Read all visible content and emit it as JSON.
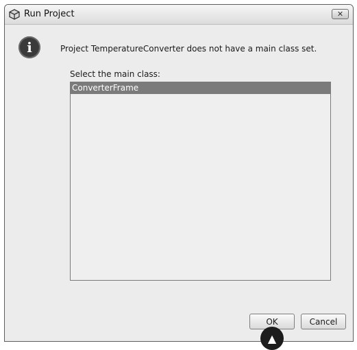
{
  "window": {
    "title": "Run Project",
    "close_symbol": "✕"
  },
  "dialog": {
    "info_icon": "i",
    "message": "Project TemperatureConverter does not have a main class set.",
    "select_label": "Select the main class:",
    "classes": [
      "ConverterFrame"
    ],
    "selected_index": 0
  },
  "buttons": {
    "ok": "OK",
    "cancel": "Cancel"
  },
  "marker": {
    "icon": "up-triangle-icon",
    "glyph": "▲"
  },
  "colors": {
    "selection": "#7b7b7b",
    "window_bg": "#ececec",
    "list_bg": "#efefef"
  }
}
